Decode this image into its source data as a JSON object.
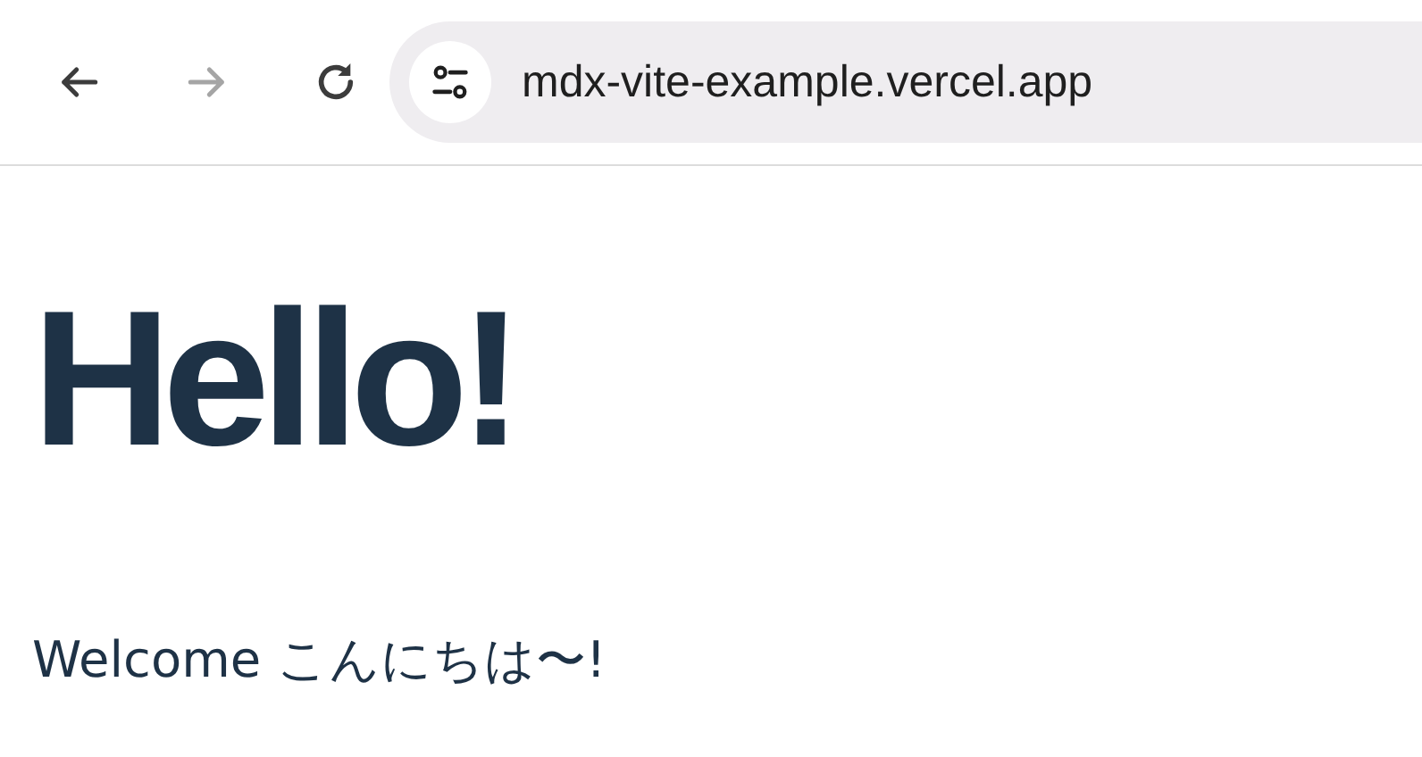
{
  "toolbar": {
    "buttons": [
      {
        "kind": "back",
        "disabled": false
      },
      {
        "kind": "forward",
        "disabled": true
      },
      {
        "kind": "reload",
        "disabled": false
      }
    ],
    "address_bar": {
      "url": "mdx-vite-example.vercel.app"
    }
  },
  "page": {
    "heading": "Hello!",
    "paragraph": "Welcome こんにちは〜!"
  }
}
